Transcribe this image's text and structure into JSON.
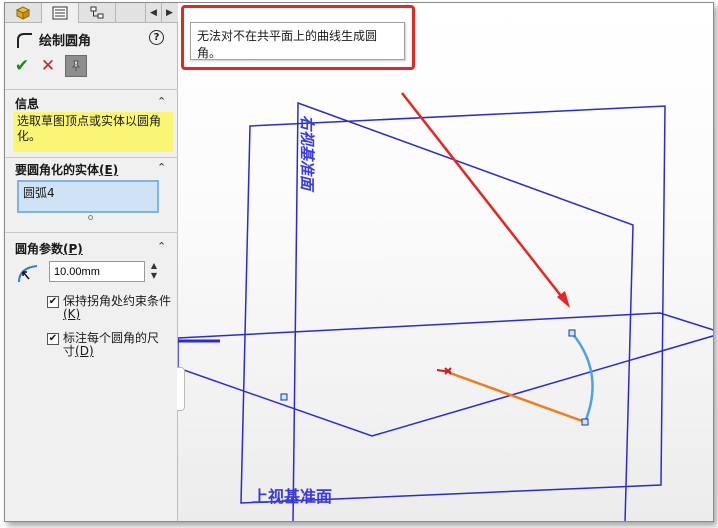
{
  "tabs": [
    {
      "icon": "feature-manager-icon",
      "active": false
    },
    {
      "icon": "property-manager-icon",
      "active": true
    },
    {
      "icon": "configuration-manager-icon",
      "active": false
    }
  ],
  "property_manager": {
    "title": "绘制圆角",
    "sections": {
      "info": {
        "title": "信息",
        "message": "选取草图顶点或实体以圆角化。"
      },
      "entities": {
        "title": "要圆角化的实体",
        "title_hotkey": "(E)",
        "items": [
          "圆弧4"
        ]
      },
      "params": {
        "title": "圆角参数",
        "title_hotkey": "(P)",
        "radius_value": "10.00mm",
        "keep_corner": {
          "label": "保持拐角处约束条件",
          "hotkey": "(K)",
          "checked": true
        },
        "dimension_each": {
          "label": "标注每个圆角的尺寸",
          "hotkey": "(D)",
          "checked": true
        }
      }
    }
  },
  "viewport": {
    "error_message": "无法对不在共平面上的曲线生成圆角。",
    "plane_labels": {
      "right": "右视基准面",
      "top": "上视基准面"
    }
  },
  "colors": {
    "plane": "#2a2ad8",
    "arc": "#4aa3e8",
    "line": "#f07c1a",
    "error": "#e8261f",
    "info_bg": "#fbf575"
  }
}
